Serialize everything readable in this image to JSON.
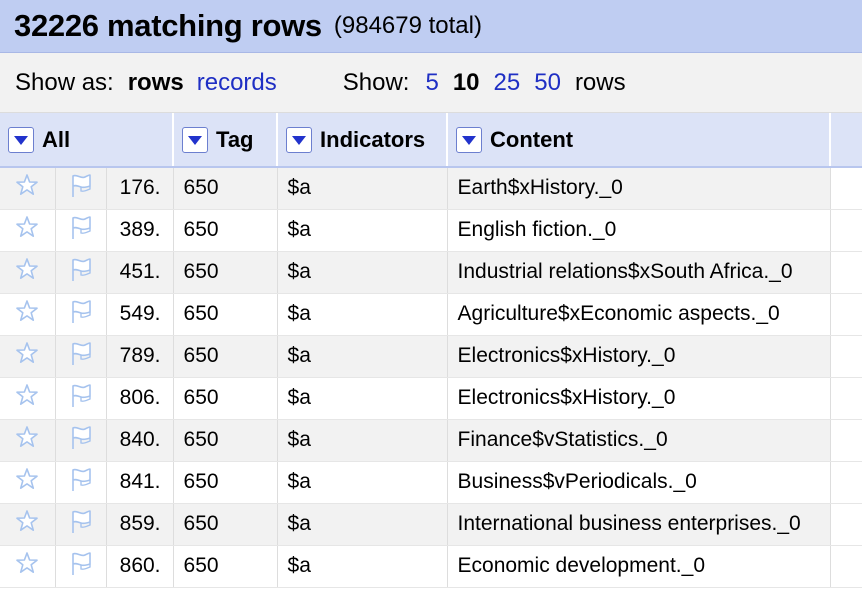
{
  "summary": {
    "count": "32226 matching rows",
    "total": "(984679 total)"
  },
  "view": {
    "show_as_label": "Show as:",
    "mode_rows": "rows",
    "mode_records": "records",
    "show_label": "Show:",
    "page_sizes": [
      "5",
      "10",
      "25",
      "50"
    ],
    "selected_page_size": "10",
    "rows_label": "rows"
  },
  "columns": {
    "all": "All",
    "tag": "Tag",
    "indicators": "Indicators",
    "content": "Content"
  },
  "icons": {
    "star": "star-icon",
    "flag": "flag-icon",
    "dropdown": "dropdown-arrow-icon"
  },
  "colors": {
    "header_bar": "#bfcdf2",
    "link": "#1f2fc4",
    "column_header": "#dce3f7",
    "icon_outline": "#a6c3ee"
  },
  "rows": [
    {
      "num": "176.",
      "tag": "650",
      "ind": "$a",
      "content": "Earth$xHistory._0"
    },
    {
      "num": "389.",
      "tag": "650",
      "ind": "$a",
      "content": "English fiction._0"
    },
    {
      "num": "451.",
      "tag": "650",
      "ind": "$a",
      "content": "Industrial relations$xSouth Africa._0"
    },
    {
      "num": "549.",
      "tag": "650",
      "ind": "$a",
      "content": "Agriculture$xEconomic aspects._0"
    },
    {
      "num": "789.",
      "tag": "650",
      "ind": "$a",
      "content": "Electronics$xHistory._0"
    },
    {
      "num": "806.",
      "tag": "650",
      "ind": "$a",
      "content": "Electronics$xHistory._0"
    },
    {
      "num": "840.",
      "tag": "650",
      "ind": "$a",
      "content": "Finance$vStatistics._0"
    },
    {
      "num": "841.",
      "tag": "650",
      "ind": "$a",
      "content": "Business$vPeriodicals._0"
    },
    {
      "num": "859.",
      "tag": "650",
      "ind": "$a",
      "content": "International business enterprises._0"
    },
    {
      "num": "860.",
      "tag": "650",
      "ind": "$a",
      "content": "Economic development._0"
    }
  ]
}
